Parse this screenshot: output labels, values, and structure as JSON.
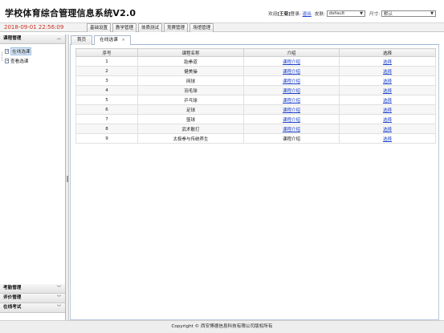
{
  "app": {
    "title": "学校体育综合管理信息系统V2.0"
  },
  "user_bar": {
    "welcome_prefix": "欢迎",
    "username": "[王菊]",
    "login_text": "登录",
    "logout_label": "退出",
    "skin_label": "皮肤:",
    "skin_value": "default",
    "size_label": "尺寸:",
    "size_value": "默认"
  },
  "navbar": {
    "datetime": "2018-09-01 22:56:09",
    "menu": [
      "基础设置",
      "教学管理",
      "体质测试",
      "竞赛管理",
      "场馆管理"
    ]
  },
  "sidebar": {
    "section_title": "课程管理",
    "items": [
      {
        "label": "在线选课",
        "selected": true
      },
      {
        "label": "查看选课",
        "selected": false
      }
    ],
    "bottom_sections": [
      "考勤管理",
      "评价管理",
      "在线考试"
    ]
  },
  "tabs": {
    "home": "首页",
    "active": "在线选课",
    "close_symbol": "×"
  },
  "table": {
    "headers": [
      "序号",
      "课程名称",
      "介绍",
      "选择"
    ],
    "rows": [
      {
        "no": "1",
        "name": "跆拳道",
        "intro": "课程介绍",
        "select": "选择",
        "intro_linked": true
      },
      {
        "no": "2",
        "name": "健美操",
        "intro": "课程介绍",
        "select": "选择",
        "intro_linked": true
      },
      {
        "no": "3",
        "name": "网球",
        "intro": "课程介绍",
        "select": "选择",
        "intro_linked": true
      },
      {
        "no": "4",
        "name": "羽毛球",
        "intro": "课程介绍",
        "select": "选择",
        "intro_linked": true
      },
      {
        "no": "5",
        "name": "乒乓球",
        "intro": "课程介绍",
        "select": "选择",
        "intro_linked": true
      },
      {
        "no": "6",
        "name": "足球",
        "intro": "课程介绍",
        "select": "选择",
        "intro_linked": true
      },
      {
        "no": "7",
        "name": "篮球",
        "intro": "课程介绍",
        "select": "选择",
        "intro_linked": true
      },
      {
        "no": "8",
        "name": "武术散打",
        "intro": "课程介绍",
        "select": "选择",
        "intro_linked": true
      },
      {
        "no": "9",
        "name": "太极拳与传统养生",
        "intro": "课程介绍",
        "select": "选择",
        "intro_linked": false
      }
    ]
  },
  "footer": {
    "copyright": "Copyright © 西安博德信息科技有限公司版权所有"
  },
  "icons": {
    "collapse": "chevron-up-double-icon",
    "expand": "chevron-down-double-icon",
    "doc": "document-icon"
  },
  "colors": {
    "datetime": "#d03020",
    "link": "#1a3fcc"
  }
}
